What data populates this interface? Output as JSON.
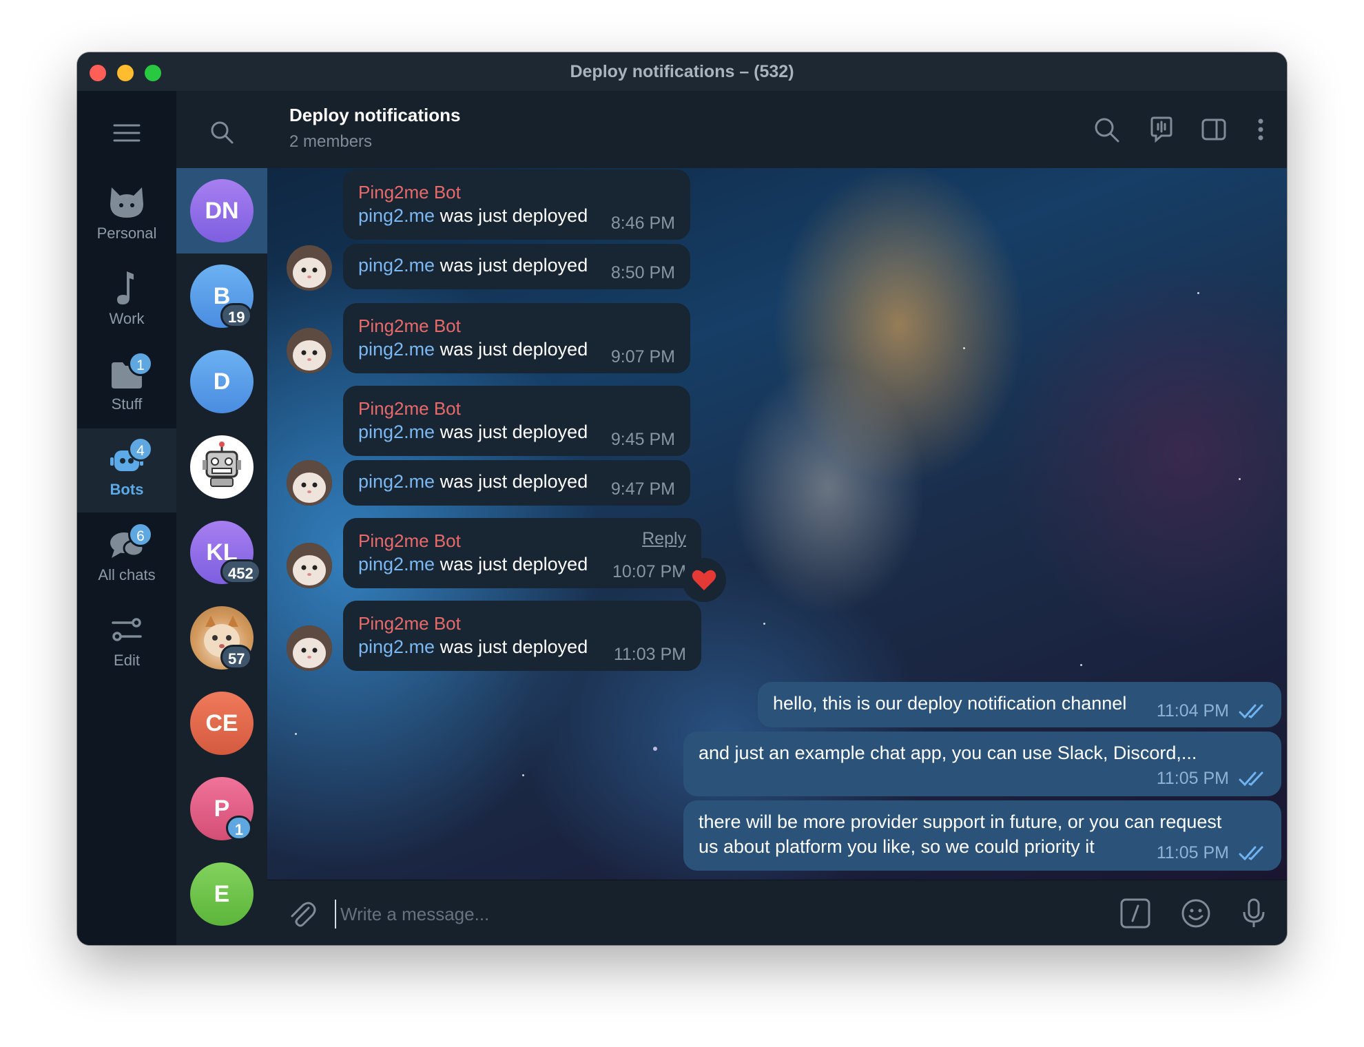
{
  "window": {
    "title": "Deploy notifications – (532)"
  },
  "folders": [
    {
      "label": "Personal",
      "icon": "cat-icon",
      "badge": ""
    },
    {
      "label": "Work",
      "icon": "music-note-icon",
      "badge": ""
    },
    {
      "label": "Stuff",
      "icon": "folder-icon",
      "badge": "1"
    },
    {
      "label": "Bots",
      "icon": "bot-icon",
      "badge": "4",
      "active": true
    },
    {
      "label": "All chats",
      "icon": "chats-icon",
      "badge": "6"
    },
    {
      "label": "Edit",
      "icon": "sliders-icon",
      "badge": ""
    }
  ],
  "chats": [
    {
      "initials": "DN",
      "color": "#8f6ee6",
      "badge": "",
      "active": true
    },
    {
      "initials": "B",
      "color": "#5a9be6",
      "badge": "19"
    },
    {
      "initials": "D",
      "color": "#5a9be6",
      "badge": ""
    },
    {
      "initials": "",
      "color": "#ffffff",
      "badge": "",
      "icon": "robot-icon"
    },
    {
      "initials": "KL",
      "color": "#9a6fe8",
      "badge": "452"
    },
    {
      "initials": "",
      "color": "#e8d3b8",
      "badge": "57",
      "icon": "cat-photo"
    },
    {
      "initials": "CE",
      "color": "#e2684e",
      "badge": ""
    },
    {
      "initials": "P",
      "color": "#e0587a",
      "badge": "1",
      "badge_style": "blue"
    },
    {
      "initials": "E",
      "color": "#6cc14a",
      "badge": ""
    }
  ],
  "header": {
    "title": "Deploy notifications",
    "subtitle": "2 members"
  },
  "messages": [
    {
      "sender": "Ping2me Bot",
      "link": "ping2.me",
      "text": " was just deployed",
      "time": "8:46 PM"
    },
    {
      "sender": "",
      "link": "ping2.me",
      "text": " was just deployed",
      "time": "8:50 PM"
    },
    {
      "sender": "Ping2me Bot",
      "link": "ping2.me",
      "text": " was just deployed",
      "time": "9:07 PM"
    },
    {
      "sender": "Ping2me Bot",
      "link": "ping2.me",
      "text": " was just deployed",
      "time": "9:45 PM"
    },
    {
      "sender": "",
      "link": "ping2.me",
      "text": " was just deployed",
      "time": "9:47 PM"
    },
    {
      "sender": "Ping2me Bot",
      "link": "ping2.me",
      "text": " was just deployed",
      "time": "10:07 PM",
      "reply": "Reply",
      "reaction": "heart"
    },
    {
      "sender": "Ping2me Bot",
      "link": "ping2.me",
      "text": " was just deployed",
      "time": "11:03 PM"
    }
  ],
  "outgoing": [
    {
      "lines": [
        "hello, this is our deploy notification channel"
      ],
      "time": "11:04 PM"
    },
    {
      "lines": [
        "and just an example chat app, you can use Slack, Discord,..."
      ],
      "time": "11:05 PM"
    },
    {
      "lines": [
        "there  will be more provider support in future, or you can request",
        "us about platform you like, so we could priority it"
      ],
      "time": "11:05 PM"
    }
  ],
  "input": {
    "placeholder": "Write a message..."
  },
  "colors": {
    "sender": "#e86a6a",
    "link": "#7bb8f2",
    "accent": "#5ea7e0",
    "outgoing_bubble": "#2b5278",
    "incoming_bubble": "#182533"
  }
}
